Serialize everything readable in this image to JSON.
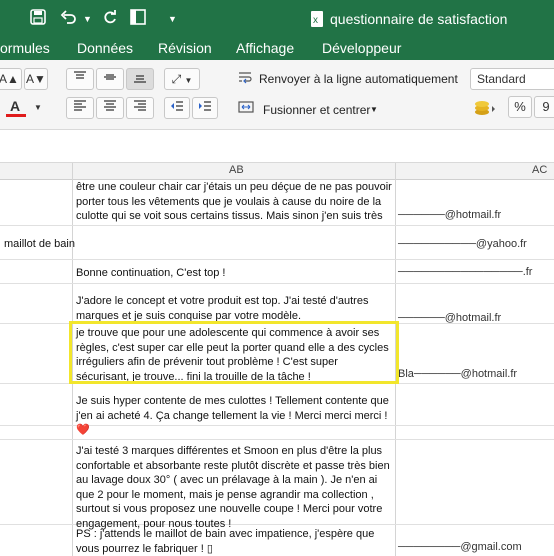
{
  "window": {
    "title": "questionnaire de satisfaction"
  },
  "toolbar_icons": [
    "save-icon",
    "undo-icon",
    "dropdown-icon",
    "redo-icon",
    "print-icon",
    "more-icon"
  ],
  "menu": {
    "tabs": [
      "ormules",
      "Données",
      "Révision",
      "Affichage",
      "Développeur"
    ]
  },
  "ribbon": {
    "font_size_up": "A▲",
    "font_size_down": "A▼",
    "font_color_button": "A",
    "wrap_text": "Renvoyer à la ligne automatiquement",
    "merge_center": "Fusionner et centrer",
    "number_format": "Standard",
    "percent": "%",
    "thousands": "9"
  },
  "columns": {
    "ab": "AB",
    "ac": "AC"
  },
  "rows": [
    {
      "left": "",
      "ab": "être une couleur chair car j'étais un peu déçue de ne pas pouvoir porter tous les vêtements que je voulais à cause du noire de la culotte qui se voit sous certains tissus. Mais sinon j'en suis très",
      "ac": "──────@hotmail.fr"
    },
    {
      "left": "maillot de bain",
      "ab": "",
      "ac": "──────────@yahoo.fr"
    },
    {
      "left": "",
      "ab": "Bonne continuation, C'est top !",
      "ac": "────────────────.fr"
    },
    {
      "left": "",
      "ab": "J'adore le concept et votre produit est top. J'ai testé d'autres marques et je suis conquise par votre modèle.",
      "ac": "──────@hotmail.fr"
    },
    {
      "left": "",
      "ab": "je trouve que pour une adolescente qui commence à avoir ses règles, c'est super car elle peut la porter quand elle a des cycles irréguliers afin de prévenir tout problème ! C'est super sécurisant, je trouve... fini la trouille de la tâche !",
      "ac": "Bla──────@hotmail.fr"
    },
    {
      "left": "",
      "ab": "Je suis hyper contente de mes culottes ! Tellement contente que j'en ai acheté 4. Ça change tellement la vie ! Merci merci merci ! ❤️",
      "ac": ""
    },
    {
      "left": "",
      "ab": "",
      "ac": ""
    },
    {
      "left": "",
      "ab": "J'ai testé 3 marques différentes et Smoon en plus d'être la plus confortable et absorbante reste plutôt discrète et passe très bien au lavage doux 30° ( avec un prélavage à la main ). Je n'en ai que 2 pour le moment, mais je pense agrandir ma collection , surtout si vous proposez une nouvelle coupe ! Merci pour votre engagement, pour nous toutes !",
      "ac": ""
    },
    {
      "left": "",
      "ab": "PS : j'attends le maillot de bain avec impatience, j'espère que vous pourrez le fabriquer ! ▯",
      "ac": "────────@gmail.com"
    }
  ]
}
